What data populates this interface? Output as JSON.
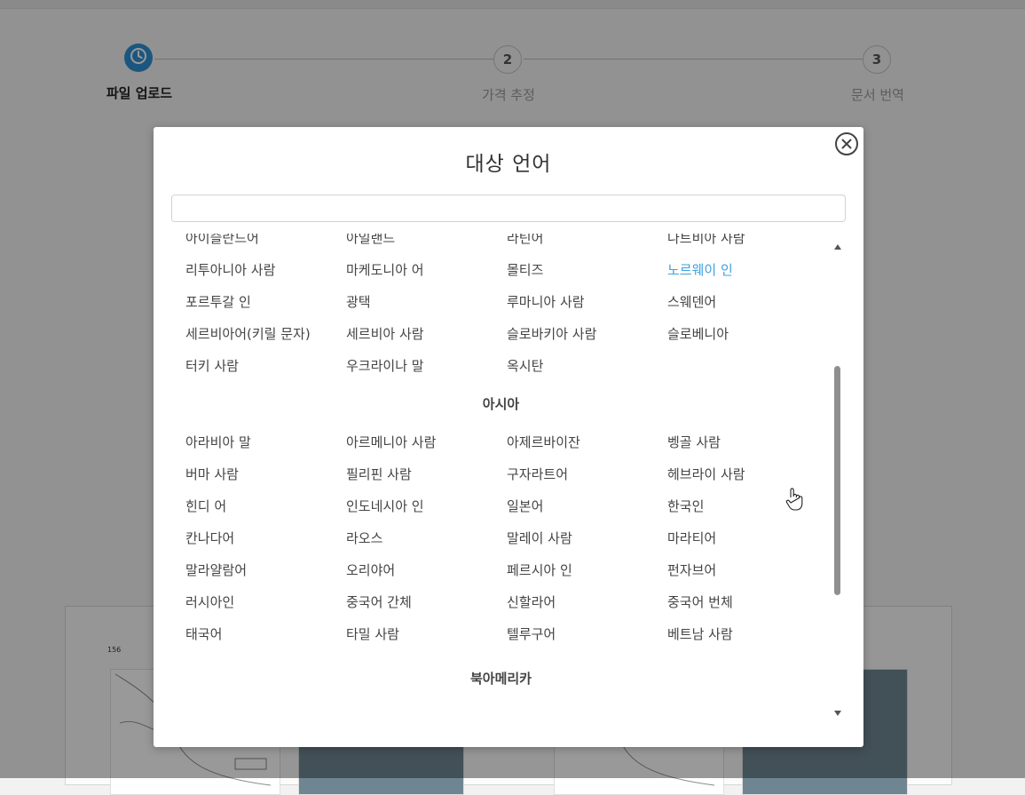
{
  "stepper": {
    "steps": [
      {
        "number": "",
        "label": "파일 업로드",
        "state": "active"
      },
      {
        "number": "2",
        "label": "가격 추정",
        "state": "inactive"
      },
      {
        "number": "3",
        "label": "문서 번역",
        "state": "inactive"
      }
    ]
  },
  "modal": {
    "title": "대상 언어",
    "search_value": "",
    "search_placeholder": "",
    "selected_language": "노르웨이 인",
    "sections": [
      {
        "region": "",
        "rows": [
          [
            "아이슬란드어",
            "아일랜드",
            "라틴어",
            "나트비아 사람"
          ],
          [
            "리투아니아 사람",
            "마케도니아 어",
            "몰티즈",
            "노르웨이 인"
          ],
          [
            "포르투갈 인",
            "광택",
            "루마니아 사람",
            "스웨덴어"
          ],
          [
            "세르비아어(키릴 문자)",
            "세르비아 사람",
            "슬로바키아 사람",
            "슬로베니아"
          ],
          [
            "터키 사람",
            "우크라이나 말",
            "옥시탄",
            ""
          ]
        ]
      },
      {
        "region": "아시아",
        "rows": [
          [
            "아라비아 말",
            "아르메니아 사람",
            "아제르바이잔",
            "벵골 사람"
          ],
          [
            "버마 사람",
            "필리핀 사람",
            "구자라트어",
            "헤브라이 사람"
          ],
          [
            "힌디 어",
            "인도네시아 인",
            "일본어",
            "한국인"
          ],
          [
            "칸나다어",
            "라오스",
            "말레이 사람",
            "마라티어"
          ],
          [
            "말라얄람어",
            "오리야어",
            "페르시아 인",
            "펀자브어"
          ],
          [
            "러시아인",
            "중국어 간체",
            "신할라어",
            "중국어 번체"
          ],
          [
            "태국어",
            "타밀 사람",
            "텔루구어",
            "베트남 사람"
          ]
        ]
      },
      {
        "region": "북아메리카",
        "rows": []
      }
    ]
  },
  "preview": {
    "page_number": "156"
  },
  "colors": {
    "accent": "#3da1de",
    "step_active": "#2f8fd2",
    "overlay": "rgba(0,0,0,0.40)",
    "text": "#444444"
  },
  "icons": {
    "step1": "clock-icon",
    "close": "close-circle-icon",
    "cursor": "hand-pointer-icon"
  }
}
